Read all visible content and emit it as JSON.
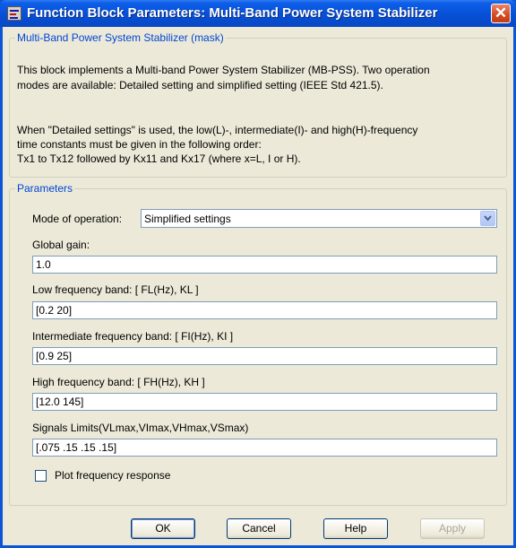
{
  "window": {
    "title": "Function Block Parameters: Multi-Band Power System Stabilizer"
  },
  "mask": {
    "legend": "Multi-Band Power System Stabilizer (mask)",
    "lines": [
      "This block implements a Multi-band Power System Stabilizer (MB-PSS). Two operation",
      "modes are available: Detailed setting and simplified setting (IEEE Std 421.5).",
      "When \"Detailed settings\" is used, the low(L)-, intermediate(I)- and high(H)-frequency",
      "time constants must be given in the following order:",
      "Tx1 to Tx12 followed by Kx11 and Kx17 (where x=L, I or H)."
    ]
  },
  "params": {
    "legend": "Parameters",
    "mode_label": "Mode of operation:",
    "mode_value": "Simplified settings",
    "global_gain_label": "Global gain:",
    "global_gain_value": "1.0",
    "low_band_label": "Low frequency band: [ FL(Hz), KL ]",
    "low_band_value": "[0.2 20]",
    "inter_band_label": "Intermediate frequency band: [ FI(Hz), KI ]",
    "inter_band_value": "[0.9 25]",
    "high_band_label": "High frequency band: [ FH(Hz), KH ]",
    "high_band_value": "[12.0 145]",
    "limits_label": "Signals Limits(VLmax,VImax,VHmax,VSmax)",
    "limits_value": "[.075 .15 .15 .15]",
    "plot_label": "Plot frequency response",
    "plot_checked": false
  },
  "buttons": {
    "ok": "OK",
    "cancel": "Cancel",
    "help": "Help",
    "apply": "Apply"
  }
}
